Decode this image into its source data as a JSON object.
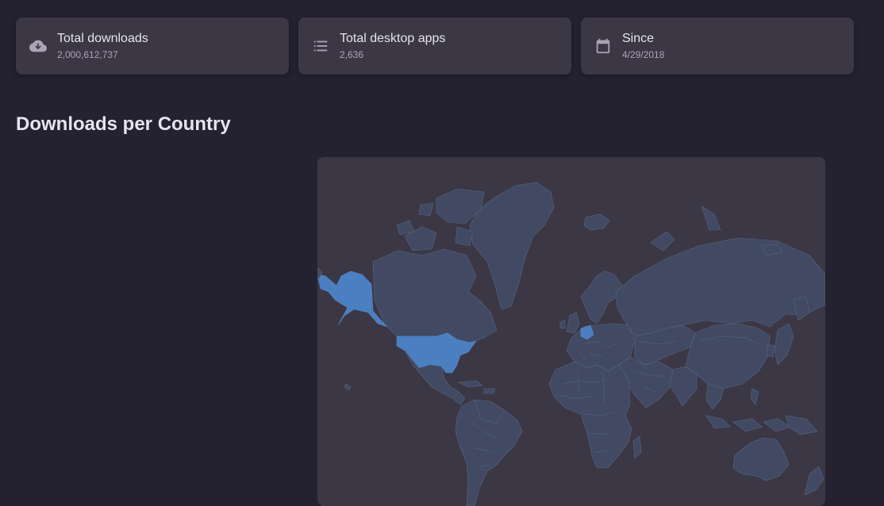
{
  "stats": [
    {
      "icon": "cloud-download-icon",
      "label": "Total downloads",
      "value": "2,000,612,737"
    },
    {
      "icon": "list-icon",
      "label": "Total desktop apps",
      "value": "2,636"
    },
    {
      "icon": "calendar-icon",
      "label": "Since",
      "value": "4/29/2018"
    }
  ],
  "section": {
    "title": "Downloads per Country"
  },
  "map": {
    "highlighted_countries": [
      "United States",
      "Alaska (US)",
      "Netherlands"
    ],
    "colors": {
      "land": "#414a62",
      "highlight": "#4a7fc1",
      "background": "#3b3745"
    }
  }
}
